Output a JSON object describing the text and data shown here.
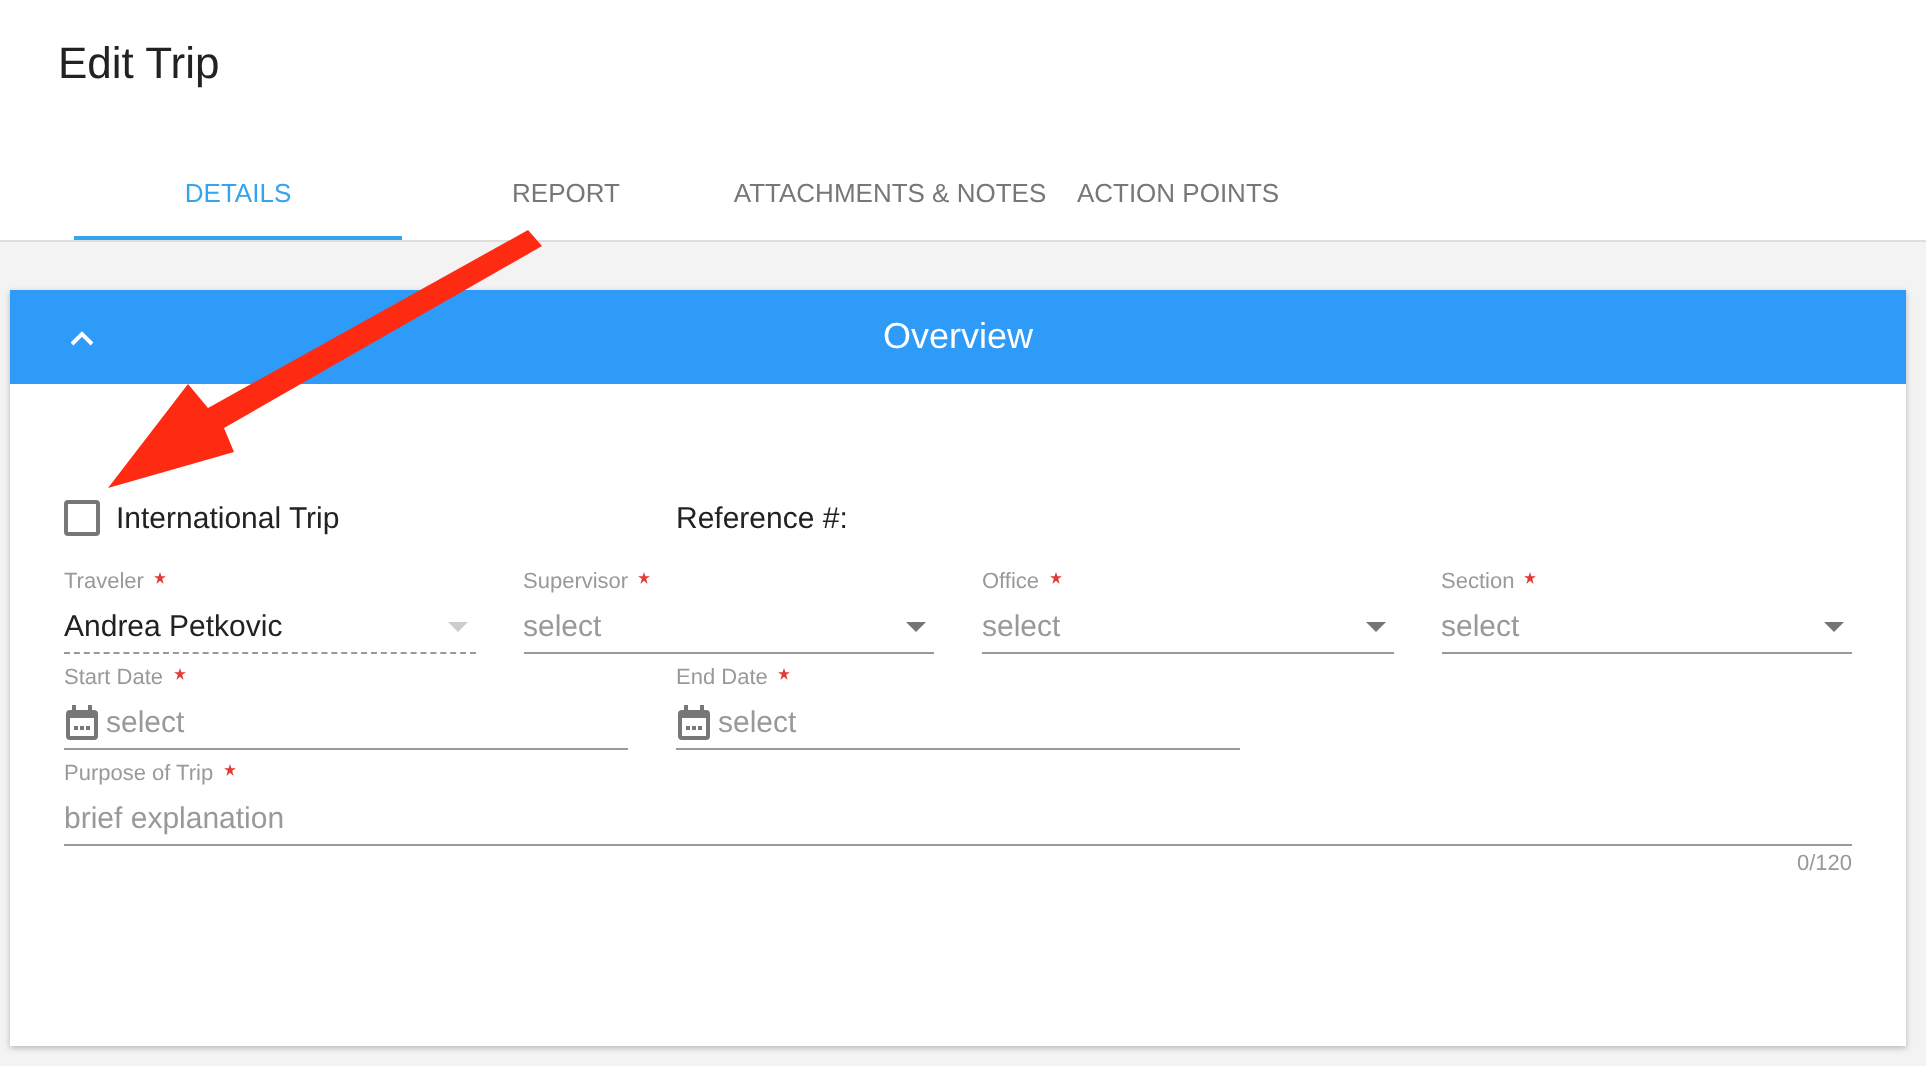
{
  "page_title": "Edit Trip",
  "tabs": [
    {
      "label": "DETAILS",
      "selected": true
    },
    {
      "label": "REPORT",
      "selected": false
    },
    {
      "label": "ATTACHMENTS & NOTES",
      "selected": false
    },
    {
      "label": "ACTION POINTS",
      "selected": false
    }
  ],
  "panel": {
    "title": "Overview",
    "expanded": true
  },
  "international_trip": {
    "label": "International Trip",
    "checked": false
  },
  "reference": {
    "label": "Reference #:"
  },
  "rows": [
    [
      {
        "kind": "select",
        "label": "Traveler",
        "required": true,
        "value": "Andrea Petkovic",
        "disabled": true
      },
      {
        "kind": "select",
        "label": "Supervisor",
        "required": true,
        "placeholder": "select",
        "disabled": false
      },
      {
        "kind": "select",
        "label": "Office",
        "required": true,
        "placeholder": "select",
        "disabled": false
      },
      {
        "kind": "select",
        "label": "Section",
        "required": true,
        "placeholder": "select",
        "disabled": false
      }
    ],
    [
      {
        "kind": "date",
        "label": "Start Date",
        "required": true,
        "placeholder": "select",
        "disabled": false
      },
      {
        "kind": "date",
        "label": "End Date",
        "required": true,
        "placeholder": "select",
        "disabled": false
      }
    ],
    [
      {
        "kind": "text",
        "label": "Purpose of Trip",
        "required": true,
        "placeholder": "brief explanation",
        "disabled": false,
        "counter": "0/120"
      }
    ]
  ]
}
